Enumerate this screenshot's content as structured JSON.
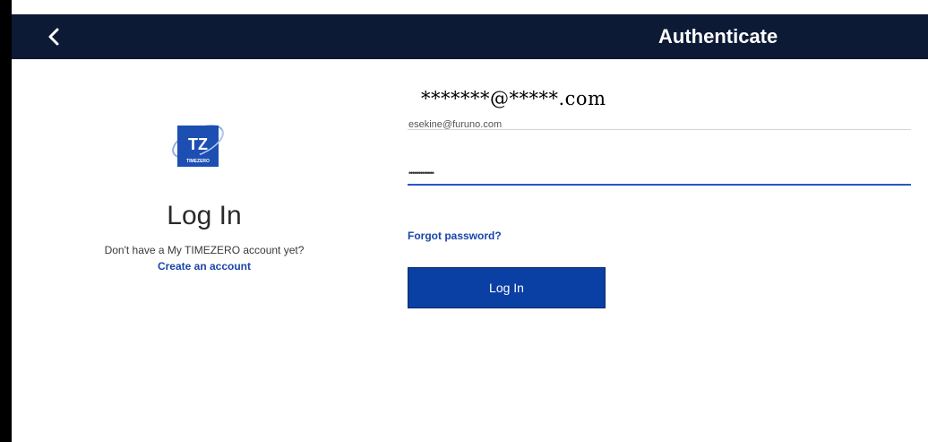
{
  "header": {
    "title": "Authenticate",
    "back_icon": "chevron-left-icon"
  },
  "left_panel": {
    "logo": {
      "icon": "timezero-logo",
      "mark": "TZ",
      "wordmark": "TIMEZERO"
    },
    "heading": "Log In",
    "no_account_text": "Don't have a My TIMEZERO account yet?",
    "create_account_link": "Create an account"
  },
  "form": {
    "email_overlay": "*******@*****.com",
    "email_value": "esekine@furuno.com",
    "password_mask": "•••••••••••••",
    "forgot_link": "Forgot password?",
    "login_button": "Log In"
  },
  "colors": {
    "header_bg": "#0d1a35",
    "accent": "#0a3fa3",
    "link": "#1a46a8",
    "focus_underline": "#2a55c4"
  }
}
